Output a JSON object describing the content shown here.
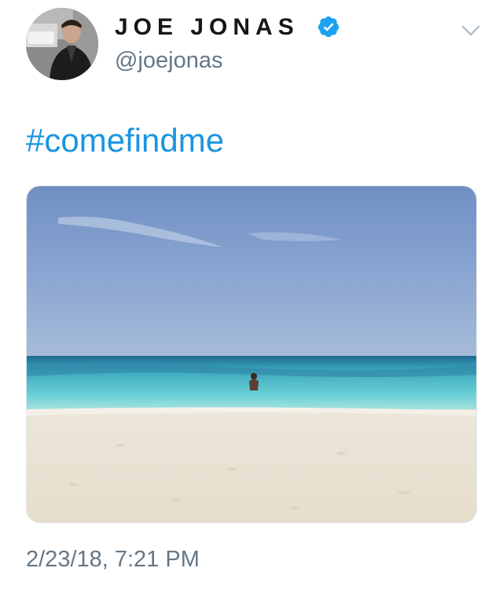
{
  "tweet": {
    "author": {
      "display_name": "JOE JONAS",
      "handle": "@joejonas",
      "verified": true,
      "avatar_icon": "profile-photo"
    },
    "text": "#comefindme",
    "media": {
      "description_icon": "beach-photo"
    },
    "timestamp": "2/23/18, 7:21 PM",
    "menu_icon": "chevron-down-icon"
  },
  "colors": {
    "name": "#14171a",
    "secondary": "#657786",
    "link": "#1b95e0",
    "verified_badge": "#1da1f2"
  }
}
